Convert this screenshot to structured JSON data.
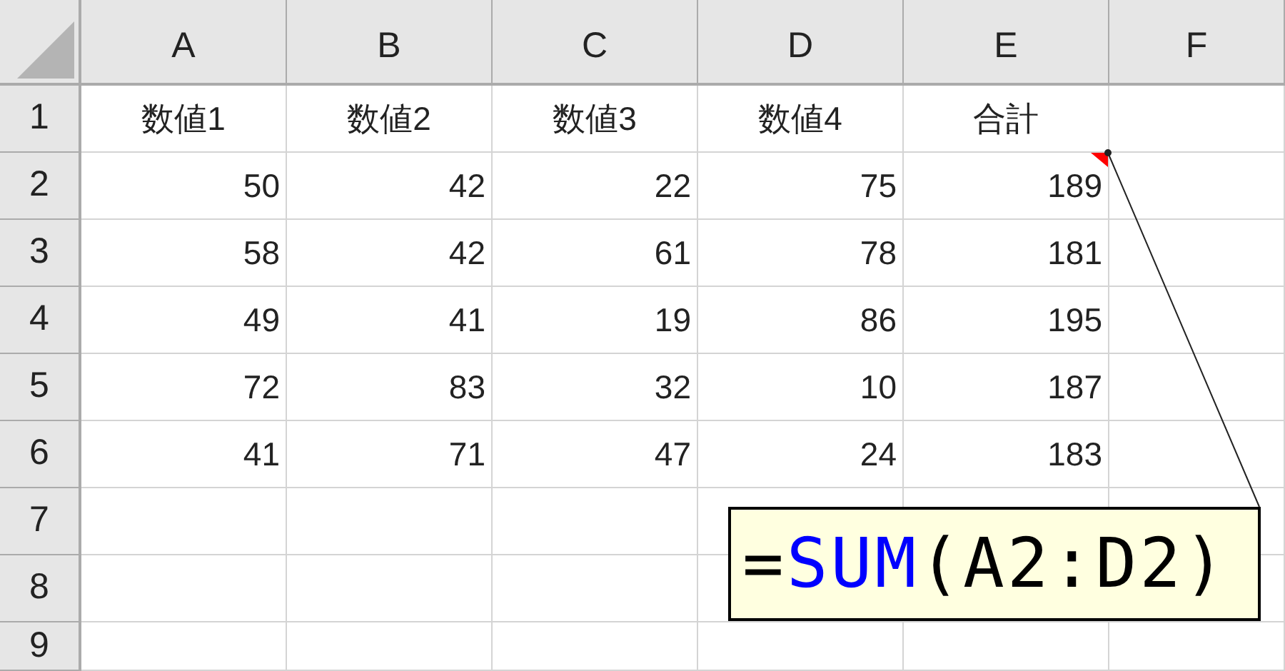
{
  "columns": [
    "A",
    "B",
    "C",
    "D",
    "E",
    "F"
  ],
  "rows": [
    {
      "header": "1",
      "kind": "label",
      "comment": false,
      "cells": [
        "数値1",
        "数値2",
        "数値3",
        "数値4",
        "合計"
      ]
    },
    {
      "header": "2",
      "kind": "number",
      "comment": true,
      "cells": [
        "50",
        "42",
        "22",
        "75",
        "189"
      ]
    },
    {
      "header": "3",
      "kind": "number",
      "comment": false,
      "cells": [
        "58",
        "42",
        "61",
        "78",
        "181"
      ]
    },
    {
      "header": "4",
      "kind": "number",
      "comment": false,
      "cells": [
        "49",
        "41",
        "19",
        "86",
        "195"
      ]
    },
    {
      "header": "5",
      "kind": "number",
      "comment": false,
      "cells": [
        "72",
        "83",
        "32",
        "10",
        "187"
      ]
    },
    {
      "header": "6",
      "kind": "number",
      "comment": false,
      "cells": [
        "41",
        "71",
        "47",
        "24",
        "183"
      ]
    },
    {
      "header": "7",
      "kind": "number",
      "comment": false,
      "cells": []
    },
    {
      "header": "8",
      "kind": "number",
      "comment": false,
      "cells": []
    },
    {
      "header": "9",
      "kind": "number",
      "comment": false,
      "cells": []
    }
  ],
  "callout": {
    "parts": [
      {
        "text": "=",
        "color": "#000000"
      },
      {
        "text": "SUM",
        "color": "#0000ff"
      },
      {
        "text": "(A2:D2)",
        "color": "#000000"
      }
    ]
  }
}
